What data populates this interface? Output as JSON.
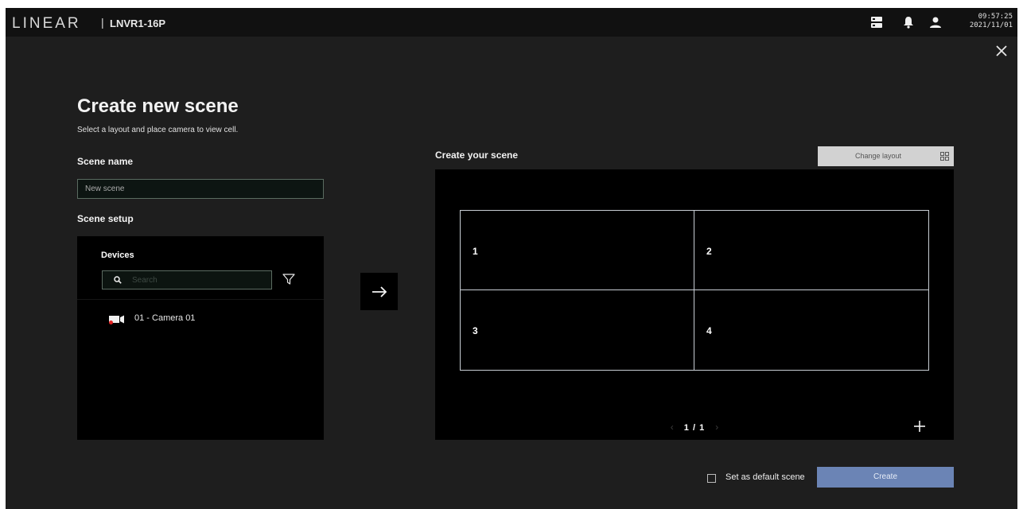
{
  "header": {
    "logo": "LINEAR",
    "separator": "|",
    "model": "LNVR1-16P",
    "icons": [
      "server-icon",
      "bell-icon",
      "user-icon"
    ],
    "time": "09:57:25",
    "date": "2021/11/01"
  },
  "page": {
    "title": "Create new scene",
    "subtitle": "Select a layout and place camera to view cell."
  },
  "scene_name": {
    "label": "Scene name",
    "value": "New scene"
  },
  "scene_setup": {
    "label": "Scene setup",
    "devices_title": "Devices",
    "search_placeholder": "Search",
    "devices": [
      {
        "label": "01 - Camera 01",
        "icon": "camera-icon",
        "status_color": "#e02424"
      }
    ]
  },
  "scene": {
    "label": "Create your scene",
    "change_layout": "Change layout",
    "cells": [
      "1",
      "2",
      "3",
      "4"
    ],
    "page_indicator": "1 / 1",
    "prev": "‹",
    "next": "›"
  },
  "footer": {
    "default_label": "Set as default scene",
    "default_checked": false,
    "create_label": "Create"
  },
  "colors": {
    "background": "#1e1e1e",
    "panel": "#000000",
    "accent": "#6b84b5",
    "camera_status": "#e02424"
  }
}
